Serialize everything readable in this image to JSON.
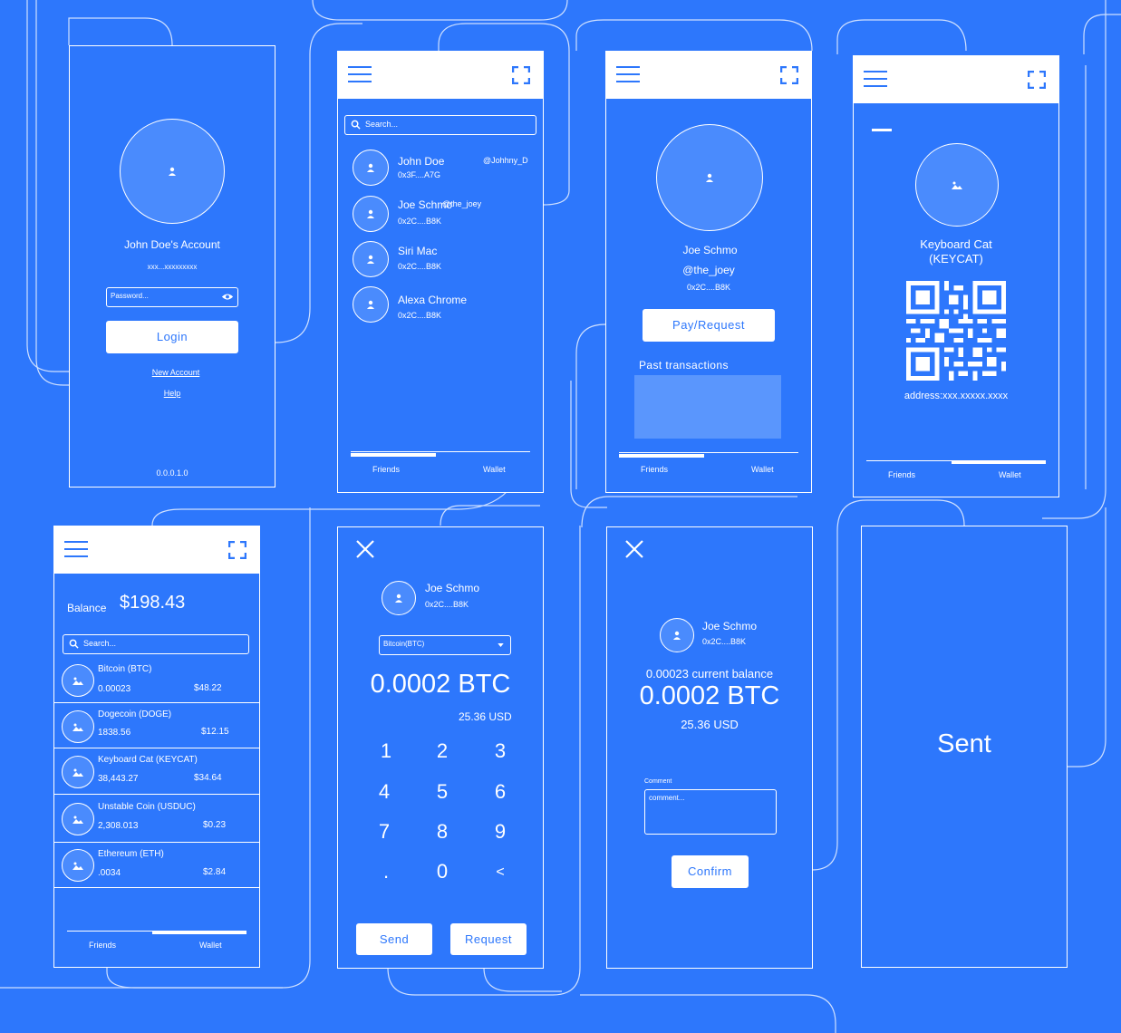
{
  "login": {
    "account_name": "John Doe's Account",
    "account_address": "xxx...xxxxxxxxx",
    "password_placeholder": "Password...",
    "login_label": "Login",
    "new_account_link": "New Account",
    "help_link": "Help",
    "version": "0.0.0.1.0"
  },
  "friends": {
    "search_placeholder": "Search...",
    "items": [
      {
        "name": "John Doe",
        "address": "0x3F....A7G",
        "handle": "@Johhny_D"
      },
      {
        "name": "Joe Schmo",
        "address": "0x2C....B8K",
        "handle": "@the_joey"
      },
      {
        "name": "Siri Mac",
        "address": "0x2C....B8K"
      },
      {
        "name": "Alexa Chrome",
        "address": "0x2C....B8K"
      }
    ],
    "tab_friends": "Friends",
    "tab_wallet": "Wallet"
  },
  "profile": {
    "name": "Joe Schmo",
    "handle": "@the_joey",
    "address": "0x2C....B8K",
    "pay_request_label": "Pay/Request",
    "past_transactions_label": "Past transactions",
    "tab_friends": "Friends",
    "tab_wallet": "Wallet"
  },
  "coin_detail": {
    "coin_name": "Keyboard Cat",
    "coin_symbol": "(KEYCAT)",
    "address": "address:xxx.xxxxx.xxxx",
    "tab_friends": "Friends",
    "tab_wallet": "Wallet"
  },
  "wallet": {
    "balance_label": "Balance",
    "balance_value": "$198.43",
    "search_placeholder": "Search...",
    "coins": [
      {
        "name": "Bitcoin (BTC)",
        "amount": "0.00023",
        "value": "$48.22"
      },
      {
        "name": "Dogecoin (DOGE)",
        "amount": "1838.56",
        "value": "$12.15"
      },
      {
        "name": "Keyboard Cat (KEYCAT)",
        "amount": "38,443.27",
        "value": "$34.64"
      },
      {
        "name": "Unstable Coin (USDUC)",
        "amount": "2,308.013",
        "value": "$0.23"
      },
      {
        "name": "Ethereum (ETH)",
        "amount": ".0034",
        "value": "$2.84"
      }
    ],
    "tab_friends": "Friends",
    "tab_wallet": "Wallet"
  },
  "pay": {
    "name": "Joe Schmo",
    "address": "0x2C....B8K",
    "currency_selected": "Bitcoin(BTC)",
    "amount": "0.0002 BTC",
    "usd": "25.36 USD",
    "keys": [
      "1",
      "2",
      "3",
      "4",
      "5",
      "6",
      "7",
      "8",
      "9",
      ".",
      "0",
      "<"
    ],
    "send_label": "Send",
    "request_label": "Request"
  },
  "confirm": {
    "name": "Joe Schmo",
    "address": "0x2C....B8K",
    "current_balance": "0.00023 current balance",
    "amount": "0.0002 BTC",
    "usd": "25.36 USD",
    "comment_label": "Comment",
    "comment_placeholder": "comment...",
    "confirm_label": "Confirm"
  },
  "sent": {
    "message": "Sent"
  },
  "colors": {
    "background": "#2d77fc",
    "foreground": "#ffffff",
    "avatar_fill": "#4a8bfd",
    "transactions_fill": "#5a96fd"
  }
}
